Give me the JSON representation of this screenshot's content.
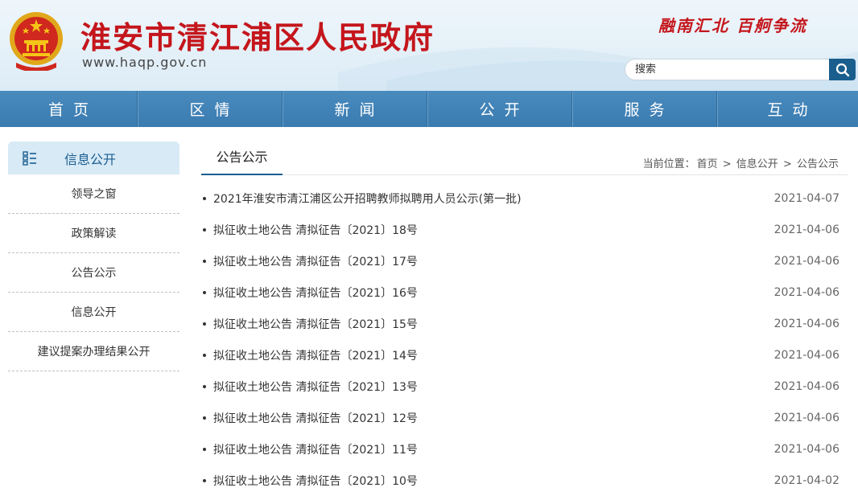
{
  "header": {
    "site_title": "淮安市清江浦区人民政府",
    "site_url": "www.haqp.gov.cn",
    "slogan": "融南汇北 百舸争流",
    "search_placeholder": "搜索",
    "brand_red": "#c4161c",
    "icons": {
      "emblem": "national-emblem-icon",
      "search": "search-icon"
    }
  },
  "nav": {
    "items": [
      "首页",
      "区情",
      "新闻",
      "公开",
      "服务",
      "互动"
    ],
    "bg_color": "#3f81b5"
  },
  "sidebar": {
    "header": "信息公开",
    "header_icon": "list-icon",
    "items": [
      "领导之窗",
      "政策解读",
      "公告公示",
      "信息公开",
      "建议提案办理结果公开"
    ]
  },
  "main": {
    "tab_title": "公告公示",
    "breadcrumb": {
      "prefix": "当前位置：",
      "items": [
        "首页",
        "信息公开",
        "公告公示"
      ],
      "separator": ">"
    },
    "list": [
      {
        "title": "2021年淮安市清江浦区公开招聘教师拟聘用人员公示(第一批)",
        "date": "2021-04-07"
      },
      {
        "title": "拟征收土地公告 清拟征告〔2021〕18号",
        "date": "2021-04-06"
      },
      {
        "title": "拟征收土地公告 清拟征告〔2021〕17号",
        "date": "2021-04-06"
      },
      {
        "title": "拟征收土地公告 清拟征告〔2021〕16号",
        "date": "2021-04-06"
      },
      {
        "title": "拟征收土地公告 清拟征告〔2021〕15号",
        "date": "2021-04-06"
      },
      {
        "title": "拟征收土地公告 清拟征告〔2021〕14号",
        "date": "2021-04-06"
      },
      {
        "title": "拟征收土地公告 清拟征告〔2021〕13号",
        "date": "2021-04-06"
      },
      {
        "title": "拟征收土地公告 清拟征告〔2021〕12号",
        "date": "2021-04-06"
      },
      {
        "title": "拟征收土地公告 清拟征告〔2021〕11号",
        "date": "2021-04-06"
      },
      {
        "title": "拟征收土地公告 清拟征告〔2021〕10号",
        "date": "2021-04-02"
      }
    ]
  }
}
